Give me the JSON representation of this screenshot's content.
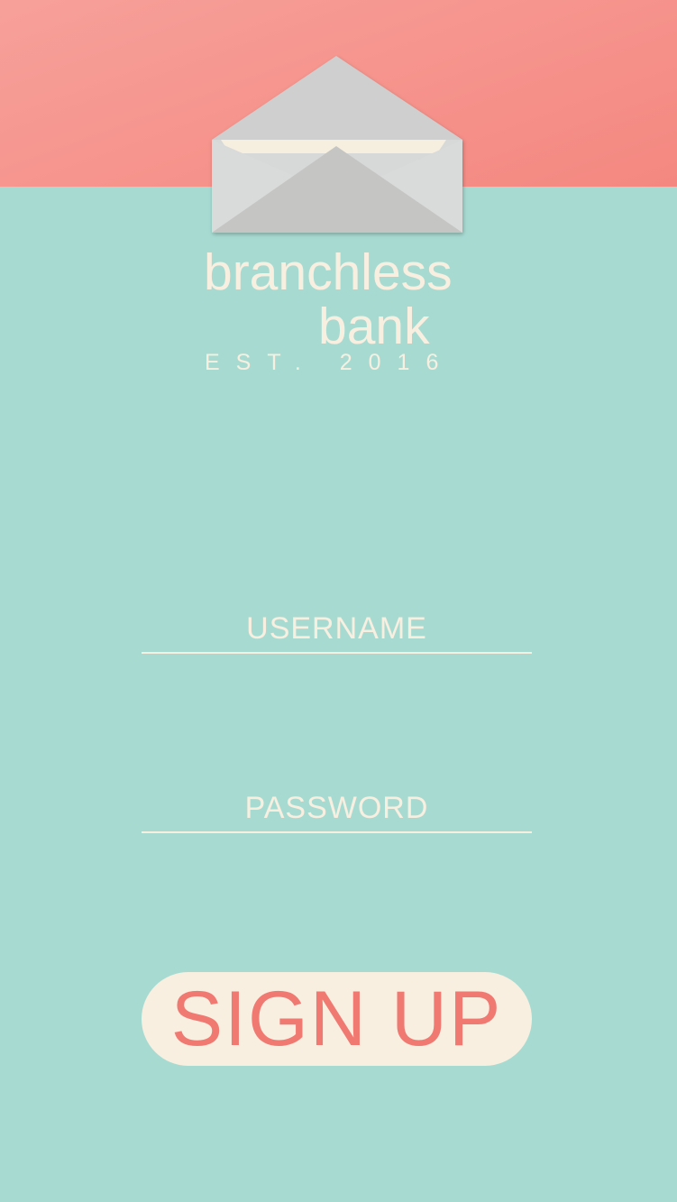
{
  "brand": {
    "line1": "branchless",
    "line2": "bank",
    "est": "EST. 2016",
    "icon": "envelope-icon"
  },
  "form": {
    "username_label": "USERNAME",
    "password_label": "PASSWORD",
    "signup_label": "SIGN UP"
  },
  "colors": {
    "coral": "#f48880",
    "mint": "#a7dbd2",
    "cream": "#f8efe1",
    "button_text": "#f07a72"
  }
}
